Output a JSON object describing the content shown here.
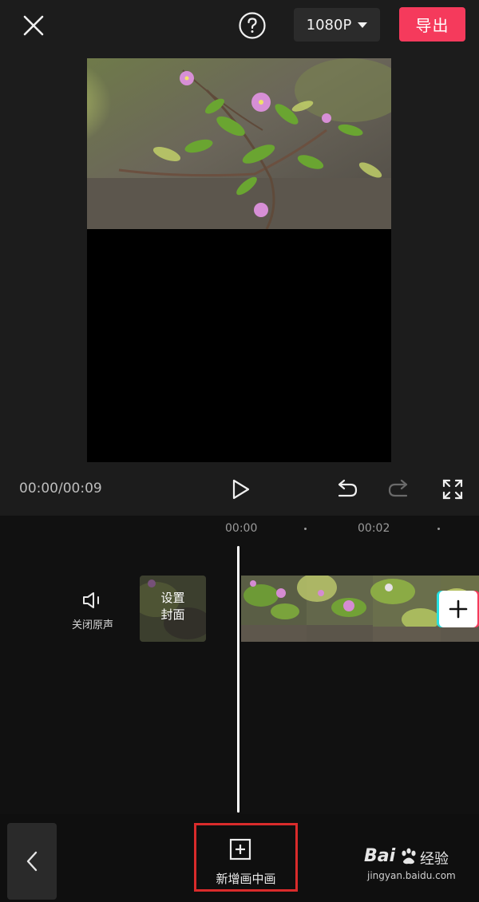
{
  "header": {
    "close_icon": "close-icon",
    "help_icon": "help-icon",
    "resolution": "1080P",
    "export_label": "导出",
    "accent_color": "#f53a5c"
  },
  "player": {
    "timecode": "00:00/00:09",
    "play_icon": "play-icon",
    "undo_icon": "undo-icon",
    "redo_icon": "redo-icon",
    "fullscreen_icon": "fullscreen-icon"
  },
  "timeline": {
    "ticks": [
      "00:00",
      "00:02"
    ],
    "mute_label": "关闭原声",
    "cover_line1": "设置",
    "cover_line2": "封面",
    "add_icon": "plus-icon"
  },
  "bottom": {
    "back_icon": "chevron-left-icon",
    "pip_label": "新增画中画",
    "pip_icon": "plus-square-icon"
  },
  "watermark": {
    "brand": "Bai",
    "brand_suffix": "经验",
    "url": "jingyan.baidu.com"
  }
}
